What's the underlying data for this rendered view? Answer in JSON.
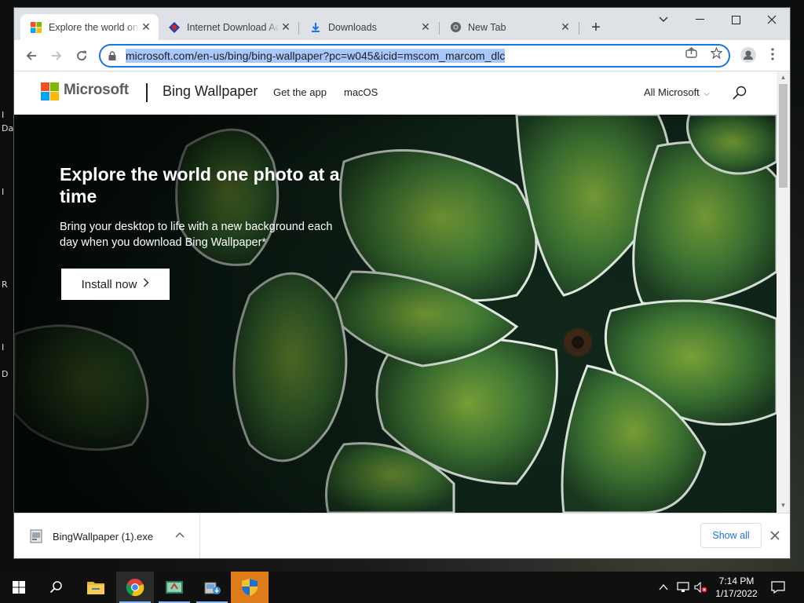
{
  "browser": {
    "tabs": [
      {
        "title": "Explore the world one photo at a time",
        "favicon": "microsoft-logo",
        "active": true
      },
      {
        "title": "Internet Download Accelerator",
        "favicon": "ida-icon",
        "active": false
      },
      {
        "title": "Downloads",
        "favicon": "download-icon",
        "active": false
      },
      {
        "title": "New Tab",
        "favicon": "chrome-icon",
        "active": false
      }
    ],
    "address_bar": {
      "url": "microsoft.com/en-us/bing/bing-wallpaper?pc=w045&icid=mscom_marcom_dlc"
    }
  },
  "page": {
    "header": {
      "brand": "Microsoft",
      "product": "Bing Wallpaper",
      "nav": [
        "Get the app",
        "macOS"
      ],
      "all_microsoft": "All Microsoft"
    },
    "hero": {
      "title": "Explore the world one photo at a time",
      "subtitle": "Bring your desktop to life with a new background each day when you download Bing Wallpaper*",
      "cta": "Install now"
    }
  },
  "download_shelf": {
    "file_name": "BingWallpaper (1).exe",
    "show_all": "Show all"
  },
  "taskbar": {
    "time": "7:14 PM",
    "date": "1/17/2022"
  },
  "colors": {
    "accent": "#1a73e8",
    "ms_red": "#f25022",
    "ms_green": "#7fba00",
    "ms_blue": "#00a4ef",
    "ms_yellow": "#ffb900"
  }
}
